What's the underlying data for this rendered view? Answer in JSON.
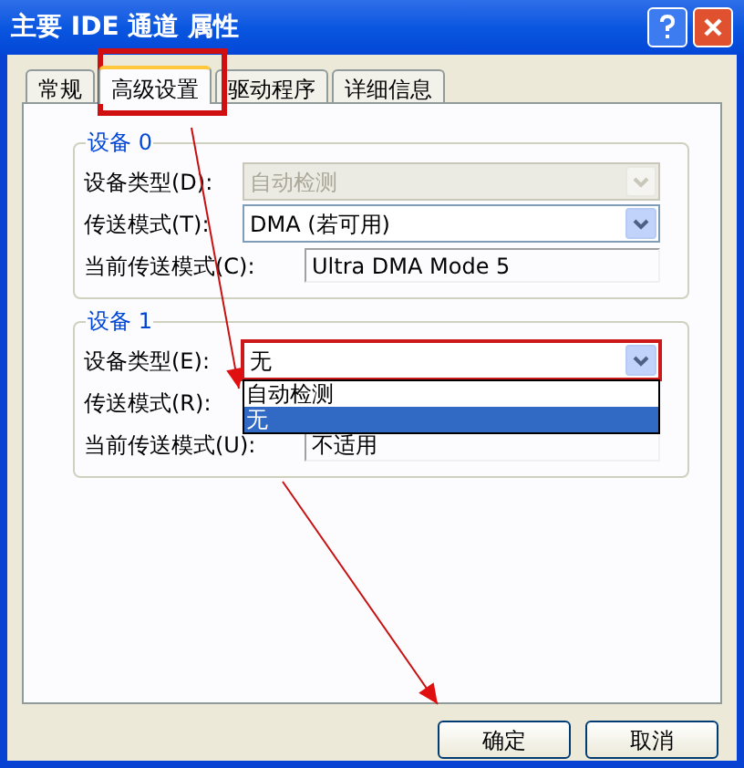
{
  "window": {
    "title": "主要 IDE 通道 属性"
  },
  "tabs": [
    {
      "label": "常规",
      "selected": false
    },
    {
      "label": "高级设置",
      "selected": true
    },
    {
      "label": "驱动程序",
      "selected": false
    },
    {
      "label": "详细信息",
      "selected": false
    }
  ],
  "groups": [
    {
      "title": "设备 0",
      "rows": [
        {
          "kind": "dropdown",
          "label": "设备类型(D):",
          "value": "自动检测",
          "disabled": true,
          "focused": false
        },
        {
          "kind": "dropdown",
          "label": "传送模式(T):",
          "value": "DMA (若可用)",
          "disabled": false,
          "focused": false
        },
        {
          "kind": "readonly",
          "label": "当前传送模式(C):",
          "value": "Ultra DMA Mode 5"
        }
      ]
    },
    {
      "title": "设备 1",
      "rows": [
        {
          "kind": "dropdown",
          "label": "设备类型(E):",
          "value": "无",
          "disabled": false,
          "focused": true,
          "options": [
            {
              "label": "自动检测",
              "selected": false
            },
            {
              "label": "无",
              "selected": true
            }
          ]
        },
        {
          "kind": "label",
          "label": "传送模式(R):"
        },
        {
          "kind": "readonly",
          "label": "当前传送模式(U):",
          "value": "不适用"
        }
      ]
    }
  ],
  "buttons": [
    "确定",
    "取消"
  ]
}
